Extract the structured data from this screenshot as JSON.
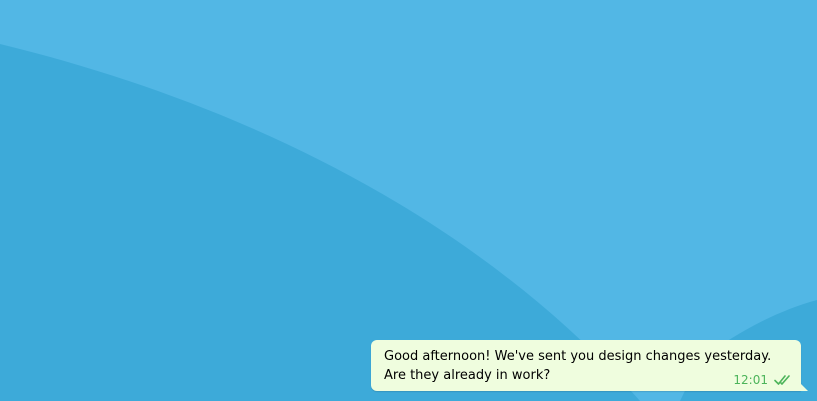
{
  "colors": {
    "background": "#52b7e5",
    "background_shape": "#3daad9",
    "bubble": "#effdde",
    "time": "#4cb45a",
    "check": "#4cb45a"
  },
  "message": {
    "text": "Good afternoon! We've sent you design changes yesterday. Are they already in work?",
    "time": "12:01",
    "status_icon": "double-check-icon"
  }
}
